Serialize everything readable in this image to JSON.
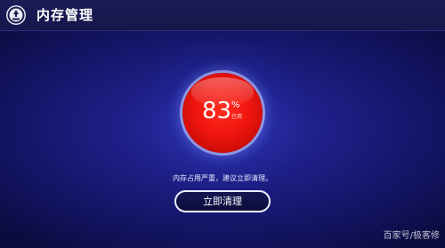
{
  "header": {
    "title": "内存管理",
    "icon": "memory-manager-icon"
  },
  "gauge": {
    "value": "83",
    "unit": "%",
    "caption": "已用",
    "fill_color": "#f0160f"
  },
  "message": "内存占用严重，建议立即清理。",
  "button": {
    "label": "立即清理"
  },
  "watermark": "百家号/极客修"
}
